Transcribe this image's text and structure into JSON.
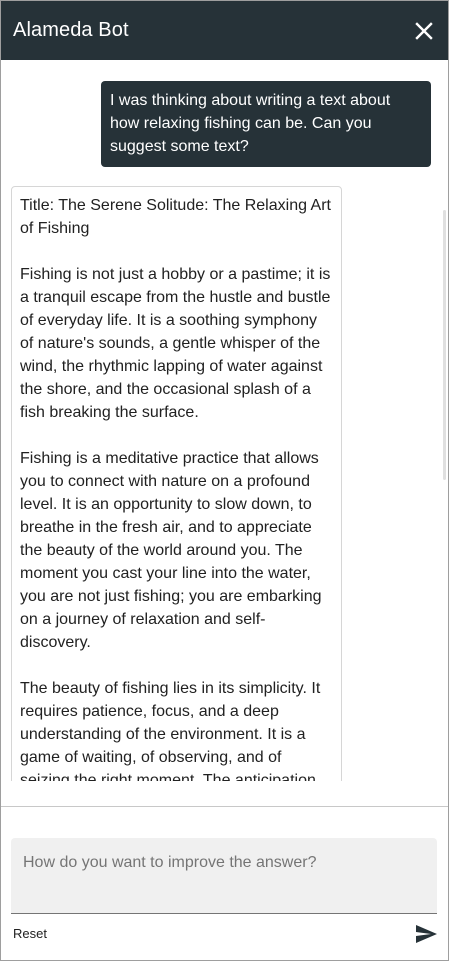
{
  "header": {
    "title": "Alameda Bot",
    "close_icon": "close-icon"
  },
  "conversation": {
    "user_message": "I was thinking about writing a text about how relaxing fishing can be. Can you suggest some text?",
    "bot_message": {
      "paragraphs": [
        "Title: The Serene Solitude: The Relaxing Art of Fishing",
        "Fishing is not just a hobby or a pastime; it is a tranquil escape from the hustle and bustle of everyday life. It is a soothing symphony of nature's sounds, a gentle whisper of the wind, the rhythmic lapping of water against the shore, and the occasional splash of a fish breaking the surface.",
        "Fishing is a meditative practice that allows you to connect with nature on a profound level. It is an opportunity to slow down, to breathe in the fresh air, and to appreciate the beauty of the world around you. The moment you cast your line into the water, you are not just fishing; you are embarking on a journey of relaxation and self-discovery.",
        "The beauty of fishing lies in its simplicity. It requires patience, focus, and a deep understanding of the environment. It is a game of waiting, of observing, and of seizing the right moment. The anticipation of a catch, the thrill of the bite, and the satisfaction of a"
      ]
    }
  },
  "composer": {
    "placeholder": "How do you want to improve the answer?",
    "value": "",
    "reset_label": "Reset",
    "send_icon": "send-icon"
  },
  "colors": {
    "header_bg": "#263238",
    "user_bubble_bg": "#263238",
    "input_bg": "#f0f0f0"
  }
}
